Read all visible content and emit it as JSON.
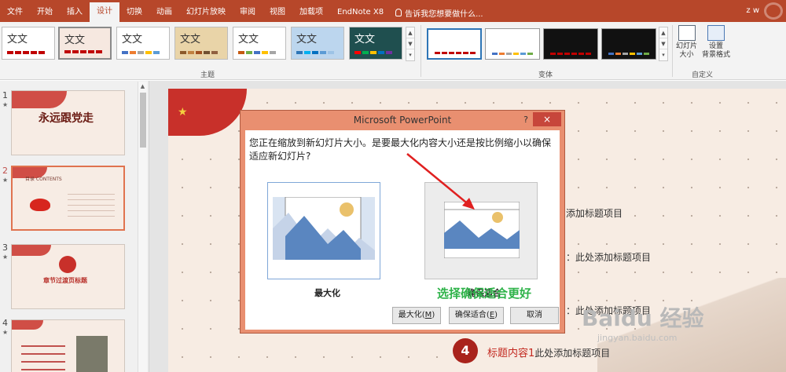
{
  "ribbon_tabs": [
    "文件",
    "开始",
    "插入",
    "设计",
    "切换",
    "动画",
    "幻灯片放映",
    "审阅",
    "视图",
    "加载项",
    "EndNote X8"
  ],
  "active_tab": "设计",
  "tell_me": "告诉我您想要做什么...",
  "user": "z w",
  "themes": {
    "items": [
      {
        "text": "文文",
        "colors": [
          "#c00000",
          "#c00000",
          "#c00000",
          "#c00000",
          "#c00000"
        ]
      },
      {
        "text": "文文",
        "colors": [
          "#c00000",
          "#c00000",
          "#c00000",
          "#c00000",
          "#c00000"
        ]
      },
      {
        "text": "文文",
        "colors": [
          "#4472c4",
          "#ed7d31",
          "#a5a5a5",
          "#ffc000",
          "#5b9bd5"
        ]
      },
      {
        "text": "文文",
        "colors": [
          "#8b5a2b",
          "#c08040",
          "#a05020",
          "#705030",
          "#906040"
        ]
      },
      {
        "text": "文文",
        "colors": [
          "#c55a11",
          "#70ad47",
          "#4472c4",
          "#ffc000",
          "#a5a5a5"
        ]
      },
      {
        "text": "文文",
        "colors": [
          "#2e75b6",
          "#00b0f0",
          "#0070c0",
          "#5b9bd5",
          "#9dc3e6"
        ]
      },
      {
        "text": "文文",
        "colors": [
          "#ff0000",
          "#00b050",
          "#ffc000",
          "#0070c0",
          "#7030a0"
        ]
      }
    ],
    "label": "主题"
  },
  "variants": {
    "label": "变体"
  },
  "customize": {
    "slide_size": "幻灯片\n大小",
    "bg_format": "设置\n背景格式",
    "label": "自定义"
  },
  "thumbnails": [
    {
      "num": "1",
      "star": "★",
      "title": "永远跟党走"
    },
    {
      "num": "2",
      "star": "★",
      "title": "目录 CONTENTS"
    },
    {
      "num": "3",
      "star": "★",
      "title": "章节过渡页标题"
    },
    {
      "num": "4",
      "star": "★",
      "title": ""
    }
  ],
  "slide": {
    "items": [
      "添加标题项目",
      "：此处添加标题项目",
      "：此处添加标题项目"
    ],
    "num4": "4",
    "title4_red": "标题内容1",
    "title4_rest": "此处添加标题项目"
  },
  "dialog": {
    "title": "Microsoft PowerPoint",
    "help": "?",
    "close": "×",
    "message": "您正在缩放到新幻灯片大小。是要最大化内容大小还是按比例缩小以确保适应新幻灯片?",
    "option_max": "最大化",
    "option_fit": "确保适合",
    "annotation": "选择确保适合更好",
    "buttons": {
      "max": "最大化(M)",
      "max_plain": "最大化(",
      "max_key": "M",
      "fit_plain": "确保适合(",
      "fit_key": "E",
      "cancel": "取消"
    }
  },
  "watermark": {
    "main": "Baidu 经验",
    "sub": "jingyan.baidu.com"
  }
}
